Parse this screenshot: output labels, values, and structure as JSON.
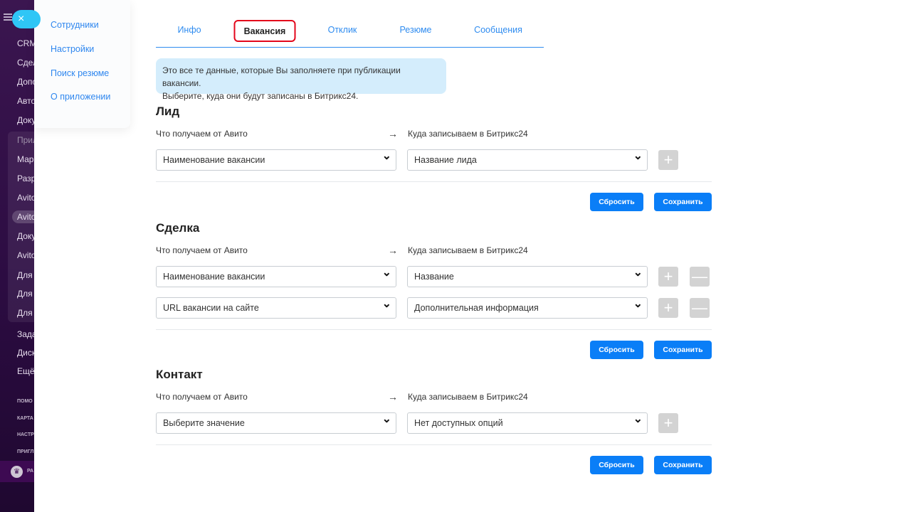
{
  "sidebar": {
    "items": [
      "CRM",
      "Сдел",
      "Допо",
      "Авто",
      "Доку",
      "Прил",
      "Марк",
      "Разр",
      "Avito",
      "Avito",
      "Доку",
      "Avito",
      "Для т",
      "Для т",
      "Для т",
      "Зада",
      "Диск",
      "Ещё"
    ],
    "small_items": [
      "ПОМО",
      "КАРТА",
      "НАСТР",
      "ПРИГЛ"
    ],
    "plan_label": "РА"
  },
  "close_icon": "×",
  "menu": {
    "items": [
      "Сотрудники",
      "Настройки",
      "Поиск резюме",
      "О приложении"
    ]
  },
  "tabs": [
    {
      "label": "Инфо"
    },
    {
      "label": "Вакансия",
      "active": true
    },
    {
      "label": "Отклик"
    },
    {
      "label": "Резюме"
    },
    {
      "label": "Сообщения"
    }
  ],
  "info": {
    "line1": "Это все те данные, которые Вы заполняете при публикации вакансии.",
    "line2": "Выберите, куда они будут записаны в Битрикс24."
  },
  "labels": {
    "from": "Что получаем от Авито",
    "arrow": "→",
    "to": "Куда записываем в Битрикс24"
  },
  "buttons": {
    "reset": "Сбросить",
    "save": "Сохранить",
    "plus": "+",
    "minus": "—"
  },
  "sections": [
    {
      "title": "Лид",
      "rows": [
        {
          "from": "Наименование вакансии",
          "to": "Название лида",
          "minus": false
        }
      ]
    },
    {
      "title": "Сделка",
      "rows": [
        {
          "from": "Наименование вакансии",
          "to": "Название",
          "minus": true
        },
        {
          "from": "URL вакансии на сайте",
          "to": "Дополнительная информация",
          "minus": true
        }
      ]
    },
    {
      "title": "Контакт",
      "rows": [
        {
          "from": "Выберите значение",
          "to": "Нет доступных опций",
          "minus": false
        }
      ]
    }
  ],
  "colors": {
    "accent": "#0a7ef7",
    "tab_link": "#2f8cf0",
    "highlight": "#e3061b",
    "info_bg": "#d4edfc"
  }
}
